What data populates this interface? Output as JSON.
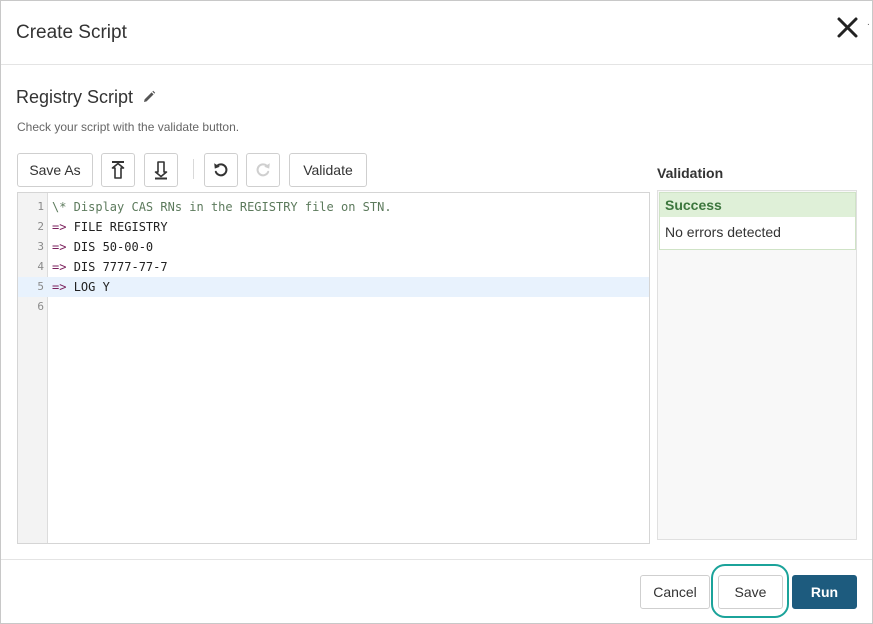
{
  "dialog": {
    "title": "Create Script",
    "edge_mark": "."
  },
  "script": {
    "name": "Registry Script",
    "hint": "Check your script with the validate button."
  },
  "toolbar": {
    "save_as_label": "Save As",
    "upload_icon": "upload-icon",
    "download_icon": "download-icon",
    "undo_icon": "undo-icon",
    "redo_icon": "redo-icon",
    "validate_label": "Validate"
  },
  "editor": {
    "lines": [
      {
        "number": "1",
        "prefix": "",
        "text": "\\* Display CAS RNs in the REGISTRY file on STN."
      },
      {
        "number": "2",
        "prefix": "=>",
        "text": "FILE REGISTRY"
      },
      {
        "number": "3",
        "prefix": "=>",
        "text": "DIS 50-00-0"
      },
      {
        "number": "4",
        "prefix": "=>",
        "text": "DIS 7777-77-7"
      },
      {
        "number": "5",
        "prefix": "=>",
        "text": "LOG Y"
      },
      {
        "number": "6",
        "prefix": "",
        "text": ""
      }
    ],
    "active_line": 5
  },
  "validation": {
    "title": "Validation",
    "status": "Success",
    "message": "No errors detected",
    "status_color": "#dff0d8"
  },
  "footer": {
    "cancel_label": "Cancel",
    "save_label": "Save",
    "run_label": "Run",
    "accent_color": "#1d5b7e",
    "focus_color": "#1ba39a"
  }
}
